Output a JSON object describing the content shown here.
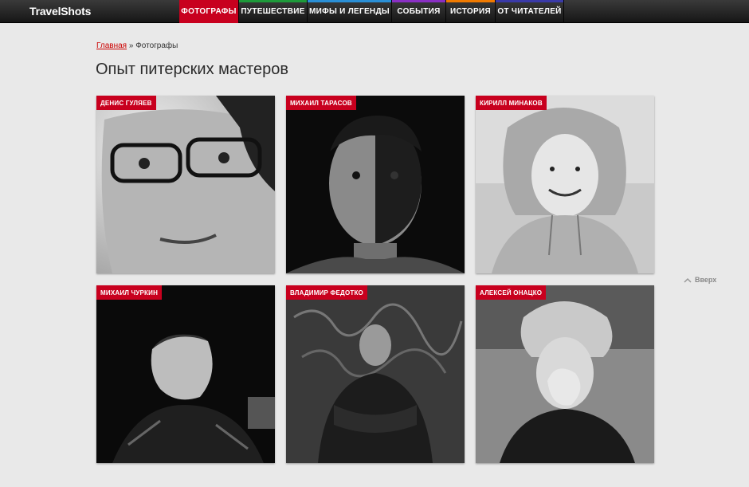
{
  "header": {
    "logo": "TravelShots",
    "nav": [
      {
        "label": "ФОТОГРАФЫ",
        "color": "#c8001e",
        "active": true
      },
      {
        "label": "ПУТЕШЕСТВИЕ",
        "color": "#1e9a3a",
        "active": false
      },
      {
        "label": "МИФЫ И ЛЕГЕНДЫ",
        "color": "#2a8fd6",
        "active": false
      },
      {
        "label": "СОБЫТИЯ",
        "color": "#8a2fc4",
        "active": false
      },
      {
        "label": "ИСТОРИЯ",
        "color": "#f07a00",
        "active": false
      },
      {
        "label": "ОТ ЧИТАТЕЛЕЙ",
        "color": "#3a3aa8",
        "active": false
      }
    ]
  },
  "breadcrumb": {
    "home": "Главная",
    "separator": " » ",
    "current": "Фотографы"
  },
  "page_title": "Опыт питерских мастеров",
  "photographers": [
    {
      "name": "ДЕНИС ГУЛЯЕВ"
    },
    {
      "name": "МИХАИЛ ТАРАСОВ"
    },
    {
      "name": "КИРИЛЛ МИНАКОВ"
    },
    {
      "name": "МИХАИЛ ЧУРКИН"
    },
    {
      "name": "ВЛАДИМИР ФЕДОТКО"
    },
    {
      "name": "АЛЕКСЕЙ ОНАЦКО"
    }
  ],
  "back_to_top": {
    "label": "Вверх",
    "icon": "chevron-up-icon"
  }
}
